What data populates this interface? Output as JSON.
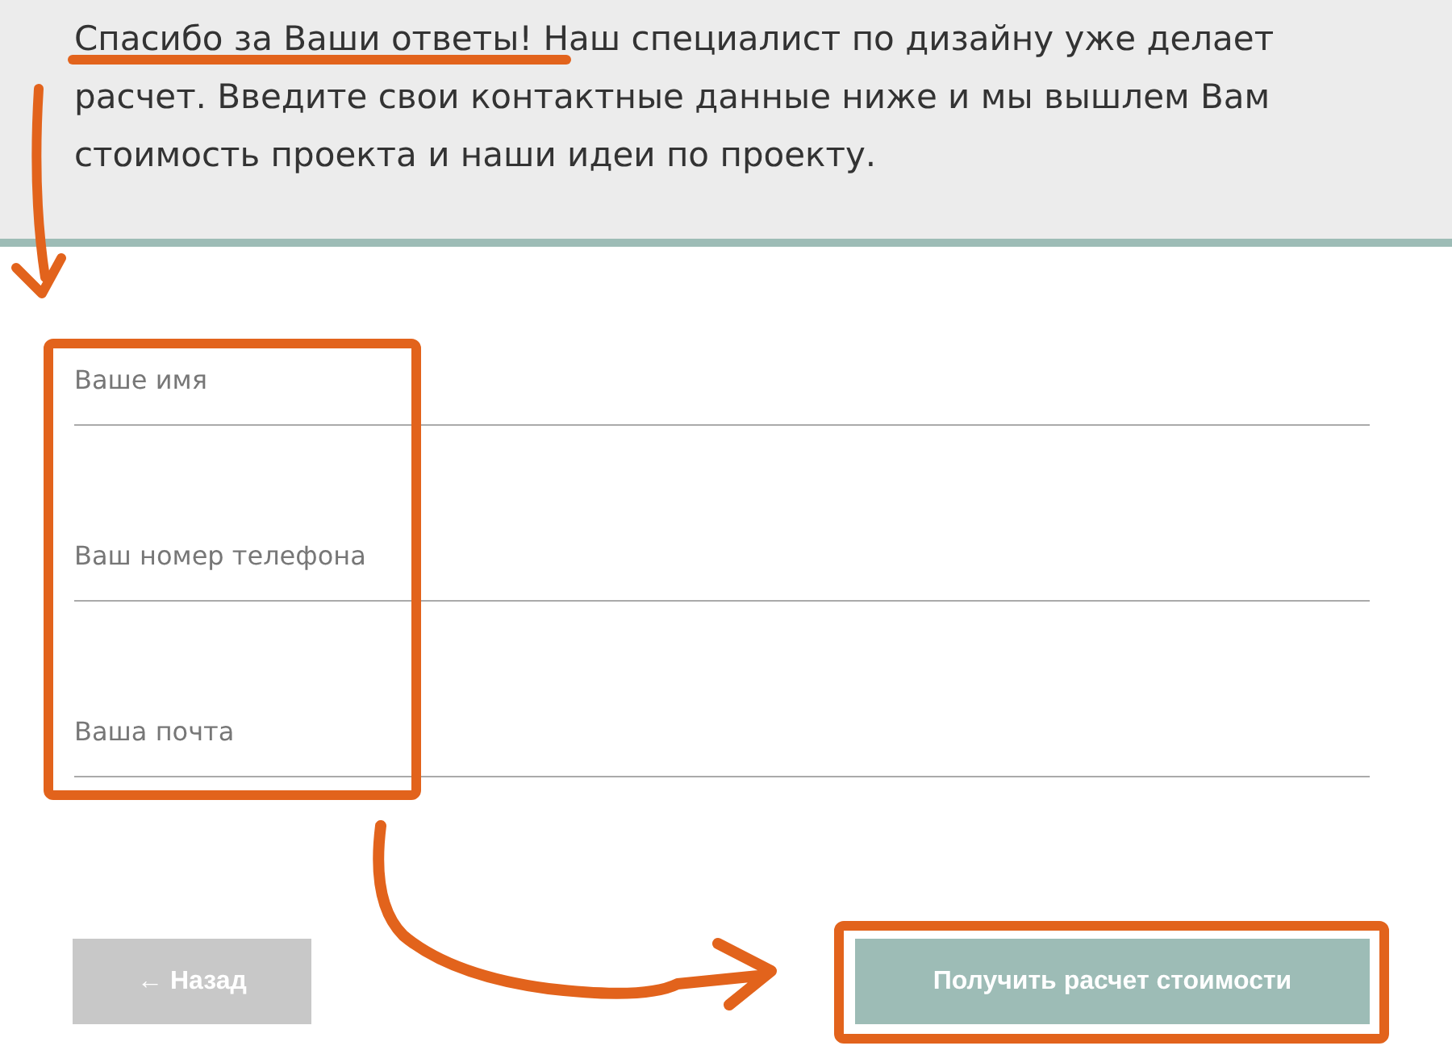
{
  "intro": {
    "text": "Спасибо за Ваши ответы! Наш специалист по дизайну уже делает расчет. Введите свои контактные данные ниже и мы вышлем Вам стоимость проекта и наши идеи по проекту."
  },
  "fields": [
    {
      "placeholder": "Ваше имя"
    },
    {
      "placeholder": "Ваш номер телефона"
    },
    {
      "placeholder": "Ваша почта"
    }
  ],
  "buttons": [
    {
      "label": "← Назад",
      "kind": "back"
    },
    {
      "label": "Получить расчет стоимости",
      "kind": "submit"
    }
  ]
}
